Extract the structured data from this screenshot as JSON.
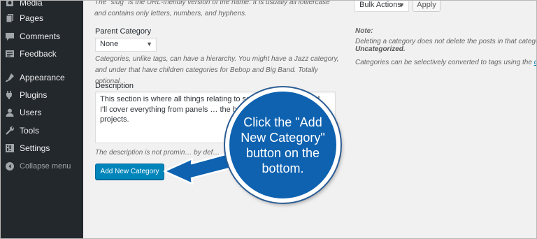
{
  "sidebar": {
    "items": [
      {
        "label": "Media",
        "icon": "media-icon"
      },
      {
        "label": "Pages",
        "icon": "pages-icon"
      },
      {
        "label": "Comments",
        "icon": "comments-icon"
      },
      {
        "label": "Feedback",
        "icon": "feedback-icon"
      },
      {
        "label": "Appearance",
        "icon": "appearance-icon"
      },
      {
        "label": "Plugins",
        "icon": "plugins-icon"
      },
      {
        "label": "Users",
        "icon": "users-icon"
      },
      {
        "label": "Tools",
        "icon": "tools-icon"
      },
      {
        "label": "Settings",
        "icon": "settings-icon"
      }
    ],
    "collapse_label": "Collapse menu",
    "background": "#23282d"
  },
  "form": {
    "slug_hint": "The \"slug\" is the URL-friendly version of the name. It is usually all lowercase and contains only letters, numbers, and hyphens.",
    "parent_label": "Parent Category",
    "parent_value": "None",
    "parent_hint": "Categories, unlike tags, can have a hierarchy. You might have a Jazz category, and under that have children categories for Bebop and Big Band. Totally optional.",
    "description_label": "Description",
    "description_value": "This section is where all things relating to solar … aics, will listed. I'll cover everything from panels … the home or personal small projects.",
    "description_hint": "The description is not promin… by def…",
    "add_button_label": "Add New Category",
    "accent": "#0085ba"
  },
  "list": {
    "bulk_actions_label": "Bulk Actions",
    "apply_label": "Apply",
    "note_title": "Note:",
    "note_line1": "Deleting a category does not delete the posts in that category.",
    "note_line2": "Uncategorized.",
    "note_line3_prefix": "Categories can be selectively converted to tags using the ",
    "note_line3_link": "categ"
  },
  "callout": {
    "text": "Click the \"Add New Category\" button on the bottom.",
    "color": "#0e62b0"
  }
}
